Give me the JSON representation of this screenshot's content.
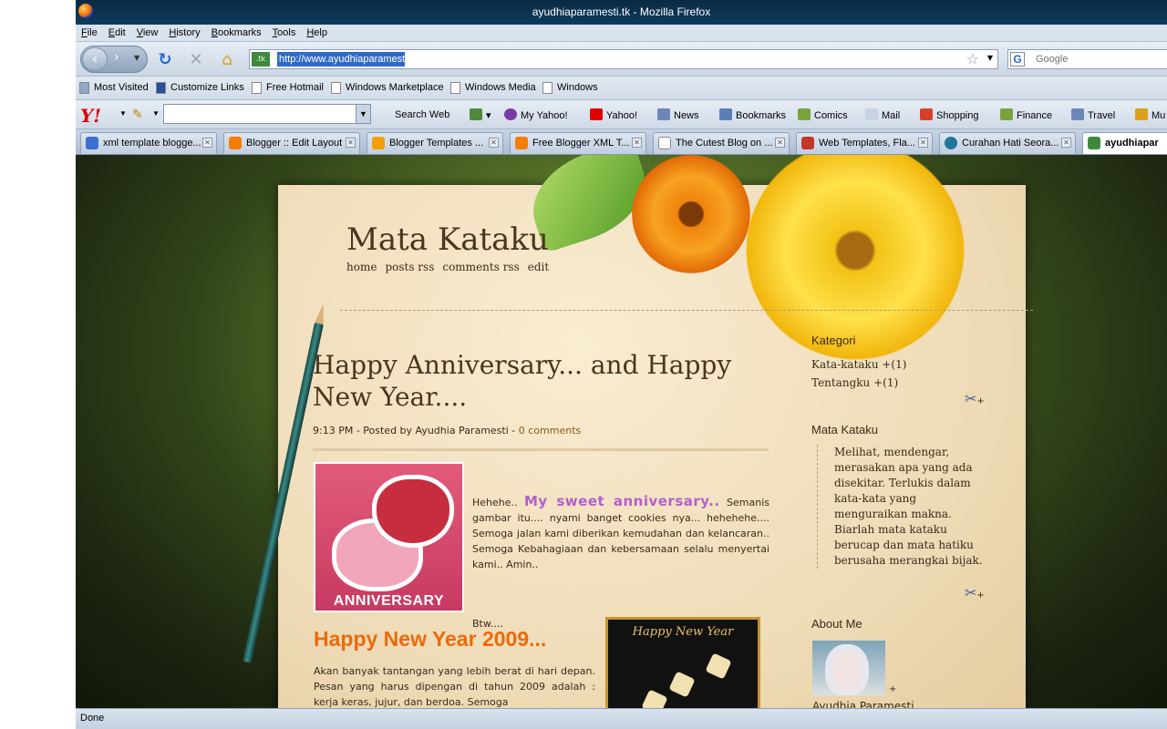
{
  "window": {
    "title": "ayudhiaparamesti.tk - Mozilla Firefox"
  },
  "menu": [
    "File",
    "Edit",
    "View",
    "History",
    "Bookmarks",
    "Tools",
    "Help"
  ],
  "nav": {
    "url": "http://www.ayudhiaparamesti.tk/",
    "search_placeholder": "Google"
  },
  "bookmarks": [
    "Most Visited",
    "Customize Links",
    "Free Hotmail",
    "Windows Marketplace",
    "Windows Media",
    "Windows"
  ],
  "yahoo": {
    "items": [
      "Search Web",
      "My Yahoo!",
      "Yahoo!",
      "News",
      "Bookmarks",
      "Comics",
      "Mail",
      "Shopping",
      "Finance",
      "Travel",
      "Mu"
    ]
  },
  "tabs": [
    {
      "label": "xml template blogge...",
      "color": "#3b6fd1"
    },
    {
      "label": "Blogger :: Edit Layout",
      "color": "#f57d00"
    },
    {
      "label": "Blogger Templates ...",
      "color": "#f2a000"
    },
    {
      "label": "Free Blogger XML T...",
      "color": "#f57d00"
    },
    {
      "label": "The Cutest Blog on ...",
      "color": "#ffffff"
    },
    {
      "label": "Web Templates, Fla...",
      "color": "#c0392b"
    },
    {
      "label": "Curahan Hati Seora...",
      "color": "#21759b"
    },
    {
      "label": "ayudhiapar",
      "color": "#3d8a3d"
    }
  ],
  "blog": {
    "title": "Mata Kataku",
    "nav": [
      "home",
      "posts rss",
      "comments rss",
      "edit"
    ],
    "post": {
      "title": "Happy Anniversary... and Happy New Year....",
      "time": "9:13 PM",
      "meta_sep1": " - Posted by ",
      "author": "Ayudhia Paramesti",
      "meta_sep2": " - ",
      "comments": "0 comments",
      "image_caption": "ANNIVERSARY",
      "intro": "Hehehe..",
      "highlight": "My sweet anniversary..",
      "body": "Semanis gambar itu.... nyami banget cookies nya... hehehehe.... Semoga jalan kami diberikan kemudahan dan kelancaran.. Semoga Kebahagiaan dan kebersamaan selalu menyertai kami.. Amin..",
      "btw": "Btw....",
      "ny_title": "Happy New Year 2009...",
      "ny_body": "Akan banyak tantangan yang lebih berat di hari depan. Pesan yang harus dipengan di tahun 2009 adalah : kerja keras, jujur, dan berdoa. Semoga",
      "ny_image_caption": "Happy New Year"
    },
    "sidebar": {
      "kategori_title": "Kategori",
      "kategori": [
        "Kata-kataku  +(1)",
        "Tentangku  +(1)"
      ],
      "about_title_blog": "Mata Kataku",
      "quote": "Melihat, mendengar, merasakan apa yang ada disekitar. Terlukis dalam kata-kata yang menguraikan makna. Biarlah mata kataku berucap dan mata hatiku berusaha merangkai bijak.",
      "about_me_title": "About Me",
      "about_name": "Ayudhia Paramesti"
    }
  },
  "status": "Done"
}
